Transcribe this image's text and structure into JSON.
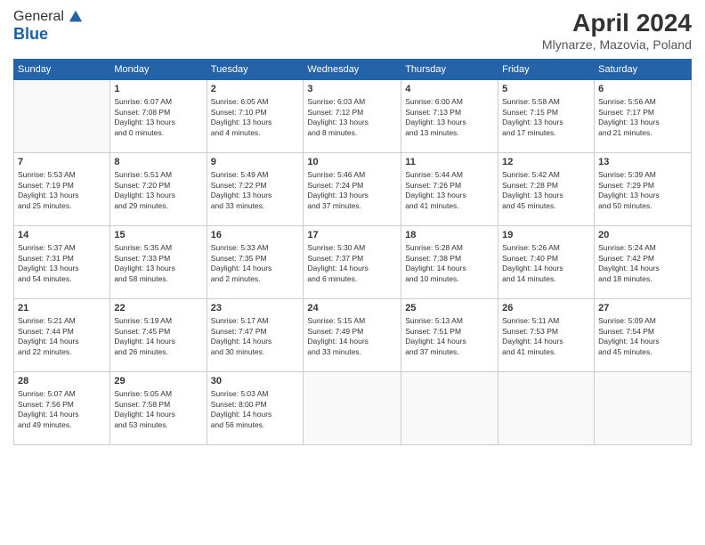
{
  "header": {
    "logo_general": "General",
    "logo_blue": "Blue",
    "title": "April 2024",
    "location": "Mlynarze, Mazovia, Poland"
  },
  "days_of_week": [
    "Sunday",
    "Monday",
    "Tuesday",
    "Wednesday",
    "Thursday",
    "Friday",
    "Saturday"
  ],
  "weeks": [
    [
      {
        "day": "",
        "info": ""
      },
      {
        "day": "1",
        "info": "Sunrise: 6:07 AM\nSunset: 7:08 PM\nDaylight: 13 hours\nand 0 minutes."
      },
      {
        "day": "2",
        "info": "Sunrise: 6:05 AM\nSunset: 7:10 PM\nDaylight: 13 hours\nand 4 minutes."
      },
      {
        "day": "3",
        "info": "Sunrise: 6:03 AM\nSunset: 7:12 PM\nDaylight: 13 hours\nand 8 minutes."
      },
      {
        "day": "4",
        "info": "Sunrise: 6:00 AM\nSunset: 7:13 PM\nDaylight: 13 hours\nand 13 minutes."
      },
      {
        "day": "5",
        "info": "Sunrise: 5:58 AM\nSunset: 7:15 PM\nDaylight: 13 hours\nand 17 minutes."
      },
      {
        "day": "6",
        "info": "Sunrise: 5:56 AM\nSunset: 7:17 PM\nDaylight: 13 hours\nand 21 minutes."
      }
    ],
    [
      {
        "day": "7",
        "info": "Sunrise: 5:53 AM\nSunset: 7:19 PM\nDaylight: 13 hours\nand 25 minutes."
      },
      {
        "day": "8",
        "info": "Sunrise: 5:51 AM\nSunset: 7:20 PM\nDaylight: 13 hours\nand 29 minutes."
      },
      {
        "day": "9",
        "info": "Sunrise: 5:49 AM\nSunset: 7:22 PM\nDaylight: 13 hours\nand 33 minutes."
      },
      {
        "day": "10",
        "info": "Sunrise: 5:46 AM\nSunset: 7:24 PM\nDaylight: 13 hours\nand 37 minutes."
      },
      {
        "day": "11",
        "info": "Sunrise: 5:44 AM\nSunset: 7:26 PM\nDaylight: 13 hours\nand 41 minutes."
      },
      {
        "day": "12",
        "info": "Sunrise: 5:42 AM\nSunset: 7:28 PM\nDaylight: 13 hours\nand 45 minutes."
      },
      {
        "day": "13",
        "info": "Sunrise: 5:39 AM\nSunset: 7:29 PM\nDaylight: 13 hours\nand 50 minutes."
      }
    ],
    [
      {
        "day": "14",
        "info": "Sunrise: 5:37 AM\nSunset: 7:31 PM\nDaylight: 13 hours\nand 54 minutes."
      },
      {
        "day": "15",
        "info": "Sunrise: 5:35 AM\nSunset: 7:33 PM\nDaylight: 13 hours\nand 58 minutes."
      },
      {
        "day": "16",
        "info": "Sunrise: 5:33 AM\nSunset: 7:35 PM\nDaylight: 14 hours\nand 2 minutes."
      },
      {
        "day": "17",
        "info": "Sunrise: 5:30 AM\nSunset: 7:37 PM\nDaylight: 14 hours\nand 6 minutes."
      },
      {
        "day": "18",
        "info": "Sunrise: 5:28 AM\nSunset: 7:38 PM\nDaylight: 14 hours\nand 10 minutes."
      },
      {
        "day": "19",
        "info": "Sunrise: 5:26 AM\nSunset: 7:40 PM\nDaylight: 14 hours\nand 14 minutes."
      },
      {
        "day": "20",
        "info": "Sunrise: 5:24 AM\nSunset: 7:42 PM\nDaylight: 14 hours\nand 18 minutes."
      }
    ],
    [
      {
        "day": "21",
        "info": "Sunrise: 5:21 AM\nSunset: 7:44 PM\nDaylight: 14 hours\nand 22 minutes."
      },
      {
        "day": "22",
        "info": "Sunrise: 5:19 AM\nSunset: 7:45 PM\nDaylight: 14 hours\nand 26 minutes."
      },
      {
        "day": "23",
        "info": "Sunrise: 5:17 AM\nSunset: 7:47 PM\nDaylight: 14 hours\nand 30 minutes."
      },
      {
        "day": "24",
        "info": "Sunrise: 5:15 AM\nSunset: 7:49 PM\nDaylight: 14 hours\nand 33 minutes."
      },
      {
        "day": "25",
        "info": "Sunrise: 5:13 AM\nSunset: 7:51 PM\nDaylight: 14 hours\nand 37 minutes."
      },
      {
        "day": "26",
        "info": "Sunrise: 5:11 AM\nSunset: 7:53 PM\nDaylight: 14 hours\nand 41 minutes."
      },
      {
        "day": "27",
        "info": "Sunrise: 5:09 AM\nSunset: 7:54 PM\nDaylight: 14 hours\nand 45 minutes."
      }
    ],
    [
      {
        "day": "28",
        "info": "Sunrise: 5:07 AM\nSunset: 7:56 PM\nDaylight: 14 hours\nand 49 minutes."
      },
      {
        "day": "29",
        "info": "Sunrise: 5:05 AM\nSunset: 7:58 PM\nDaylight: 14 hours\nand 53 minutes."
      },
      {
        "day": "30",
        "info": "Sunrise: 5:03 AM\nSunset: 8:00 PM\nDaylight: 14 hours\nand 56 minutes."
      },
      {
        "day": "",
        "info": ""
      },
      {
        "day": "",
        "info": ""
      },
      {
        "day": "",
        "info": ""
      },
      {
        "day": "",
        "info": ""
      }
    ]
  ]
}
